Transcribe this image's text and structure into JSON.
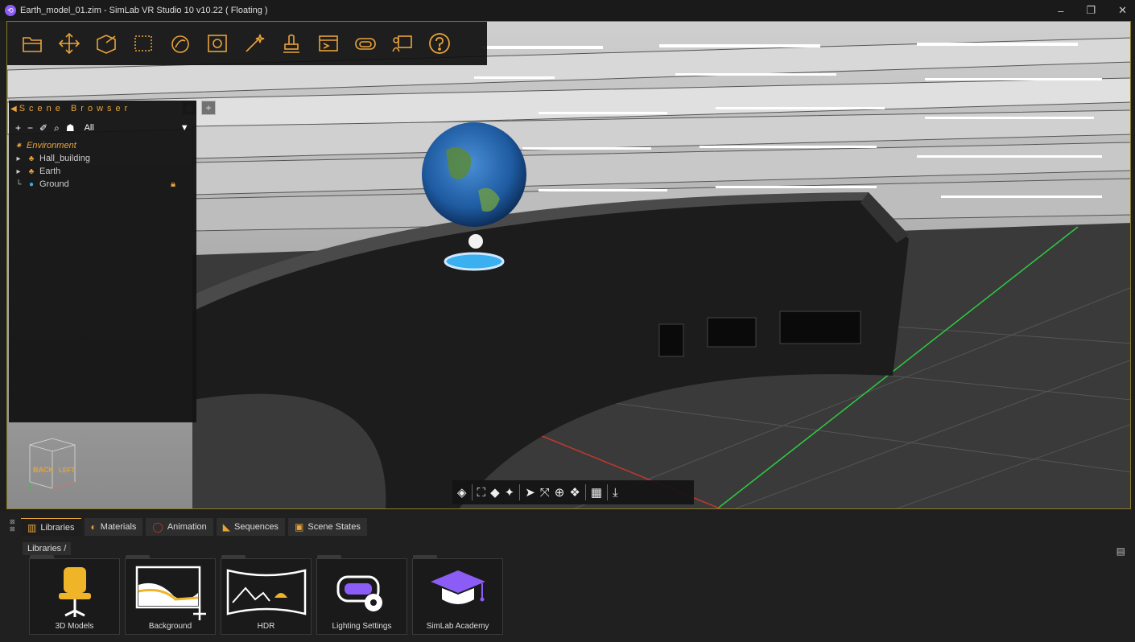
{
  "window": {
    "title": "Earth_model_01.zim - SimLab VR Studio 10 v10.22 ( Floating )",
    "minimize": "–",
    "maximize": "❐",
    "close": "✕"
  },
  "toolbar": {
    "tools": [
      "open-icon",
      "move-icon",
      "edit-object-icon",
      "select-region-icon",
      "materials-icon",
      "render-icon",
      "effects-icon",
      "touch-icon",
      "timeline-icon",
      "vr-headset-icon",
      "presentation-icon",
      "help-icon"
    ]
  },
  "scene_browser": {
    "title": "Scene Browser",
    "filter": "All",
    "filter_arrow": "▼",
    "tree": [
      {
        "label": "Environment"
      },
      {
        "label": "Hall_building"
      },
      {
        "label": "Earth"
      },
      {
        "label": "Ground",
        "locked": true
      }
    ]
  },
  "viewcube": {
    "back": "BACK",
    "left": "LEFT"
  },
  "bottom_panel": {
    "tabs": [
      {
        "label": "Libraries",
        "active": true
      },
      {
        "label": "Materials"
      },
      {
        "label": "Animation"
      },
      {
        "label": "Sequences"
      },
      {
        "label": "Scene States"
      }
    ],
    "breadcrumb": "Libraries  /",
    "libraries": [
      {
        "label": "3D Models"
      },
      {
        "label": "Background"
      },
      {
        "label": "HDR"
      },
      {
        "label": "Lighting Settings"
      },
      {
        "label": "SimLab Academy"
      }
    ]
  },
  "colors": {
    "accent": "#e8a33a",
    "viewport_border": "#8a7a2a",
    "academy": "#8b5cf6"
  }
}
